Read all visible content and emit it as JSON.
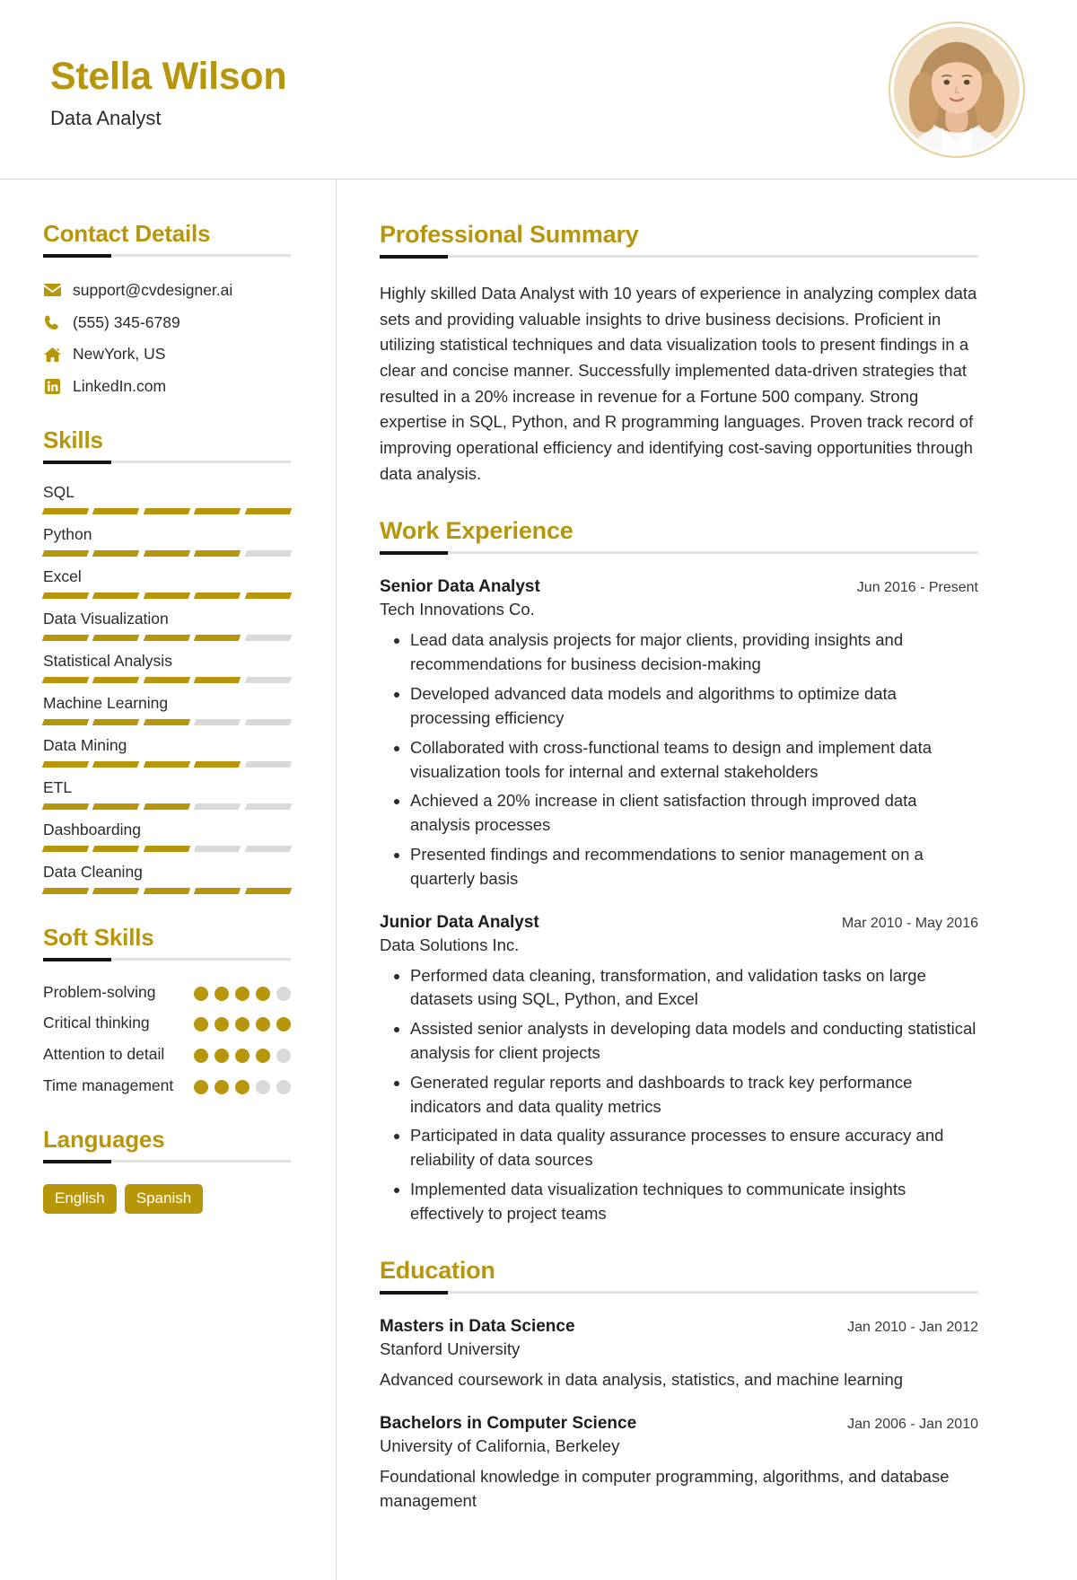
{
  "theme": {
    "accent": "#b8960c",
    "rule_dark": "#141414",
    "rule_light": "#e2e2e2",
    "muted": "#d9d9d9"
  },
  "header": {
    "name": "Stella Wilson",
    "title": "Data Analyst",
    "avatar_name": "profile-photo"
  },
  "sidebar": {
    "contact": {
      "heading": "Contact Details",
      "items": [
        {
          "icon": "envelope-icon",
          "value": "support@cvdesigner.ai"
        },
        {
          "icon": "phone-icon",
          "value": "(555) 345-6789"
        },
        {
          "icon": "home-icon",
          "value": "NewYork, US"
        },
        {
          "icon": "linkedin-icon",
          "value": "LinkedIn.com"
        }
      ]
    },
    "skills": {
      "heading": "Skills",
      "max": 5,
      "items": [
        {
          "name": "SQL",
          "level": 5
        },
        {
          "name": "Python",
          "level": 4
        },
        {
          "name": "Excel",
          "level": 5
        },
        {
          "name": "Data Visualization",
          "level": 4
        },
        {
          "name": "Statistical Analysis",
          "level": 4
        },
        {
          "name": "Machine Learning",
          "level": 3
        },
        {
          "name": "Data Mining",
          "level": 4
        },
        {
          "name": "ETL",
          "level": 3
        },
        {
          "name": "Dashboarding",
          "level": 3
        },
        {
          "name": "Data Cleaning",
          "level": 5
        }
      ]
    },
    "soft_skills": {
      "heading": "Soft Skills",
      "max": 5,
      "items": [
        {
          "name": "Problem-solving",
          "level": 4
        },
        {
          "name": "Critical thinking",
          "level": 5
        },
        {
          "name": "Attention to detail",
          "level": 4
        },
        {
          "name": "Time management",
          "level": 3
        }
      ]
    },
    "languages": {
      "heading": "Languages",
      "items": [
        "English",
        "Spanish"
      ]
    }
  },
  "main": {
    "summary": {
      "heading": "Professional Summary",
      "text": "Highly skilled Data Analyst with 10 years of experience in analyzing complex data sets and providing valuable insights to drive business decisions. Proficient in utilizing statistical techniques and data visualization tools to present findings in a clear and concise manner. Successfully implemented data-driven strategies that resulted in a 20% increase in revenue for a Fortune 500 company. Strong expertise in SQL, Python, and R programming languages. Proven track record of improving operational efficiency and identifying cost-saving opportunities through data analysis."
    },
    "experience": {
      "heading": "Work Experience",
      "entries": [
        {
          "title": "Senior Data Analyst",
          "date": "Jun 2016 - Present",
          "org": "Tech Innovations Co.",
          "bullets": [
            "Lead data analysis projects for major clients, providing insights and recommendations for business decision-making",
            "Developed advanced data models and algorithms to optimize data processing efficiency",
            "Collaborated with cross-functional teams to design and implement data visualization tools for internal and external stakeholders",
            "Achieved a 20% increase in client satisfaction through improved data analysis processes",
            "Presented findings and recommendations to senior management on a quarterly basis"
          ]
        },
        {
          "title": "Junior Data Analyst",
          "date": "Mar 2010 - May 2016",
          "org": "Data Solutions Inc.",
          "bullets": [
            "Performed data cleaning, transformation, and validation tasks on large datasets using SQL, Python, and Excel",
            "Assisted senior analysts in developing data models and conducting statistical analysis for client projects",
            "Generated regular reports and dashboards to track key performance indicators and data quality metrics",
            "Participated in data quality assurance processes to ensure accuracy and reliability of data sources",
            "Implemented data visualization techniques to communicate insights effectively to project teams"
          ]
        }
      ]
    },
    "education": {
      "heading": "Education",
      "entries": [
        {
          "title": "Masters in Data Science",
          "date": "Jan 2010 - Jan 2012",
          "org": "Stanford University",
          "desc": "Advanced coursework in data analysis, statistics, and machine learning"
        },
        {
          "title": "Bachelors in Computer Science",
          "date": "Jan 2006 - Jan 2010",
          "org": "University of California, Berkeley",
          "desc": "Foundational knowledge in computer programming, algorithms, and database management"
        }
      ]
    }
  }
}
